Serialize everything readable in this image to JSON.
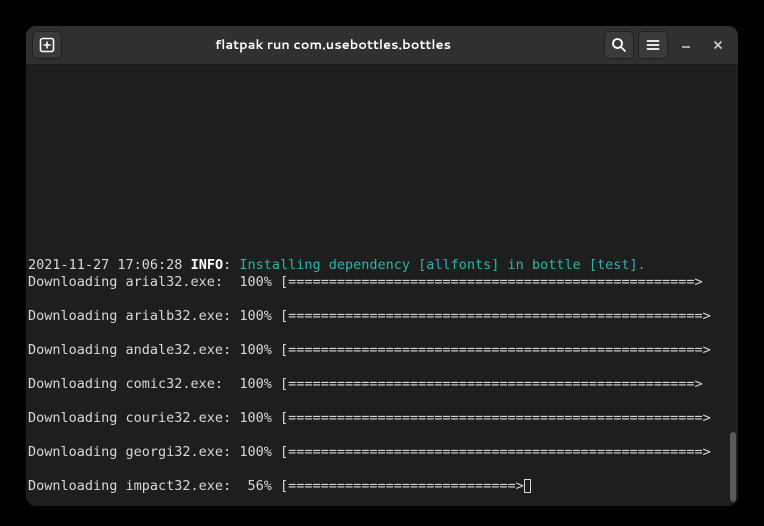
{
  "titlebar": {
    "title": "flatpak run com.usebottles.bottles"
  },
  "terminal": {
    "timestamp": "2021-11-27 17:06:28",
    "level": "INFO",
    "level_sep": ":",
    "message": "Installing dependency [allfonts] in bottle [test].",
    "downloads": [
      {
        "file": "arial32.exe",
        "pct": "100%",
        "bar": "==================================================>"
      },
      {
        "file": "arialb32.exe",
        "pct": "100%",
        "bar": "===================================================>"
      },
      {
        "file": "andale32.exe",
        "pct": "100%",
        "bar": "===================================================>"
      },
      {
        "file": "comic32.exe",
        "pct": "100%",
        "bar": "==================================================>"
      },
      {
        "file": "courie32.exe",
        "pct": "100%",
        "bar": "===================================================>"
      },
      {
        "file": "georgi32.exe",
        "pct": "100%",
        "bar": "===================================================>"
      },
      {
        "file": "impact32.exe",
        "pct": " 56%",
        "bar": "============================>"
      }
    ],
    "prefix": "Downloading "
  }
}
